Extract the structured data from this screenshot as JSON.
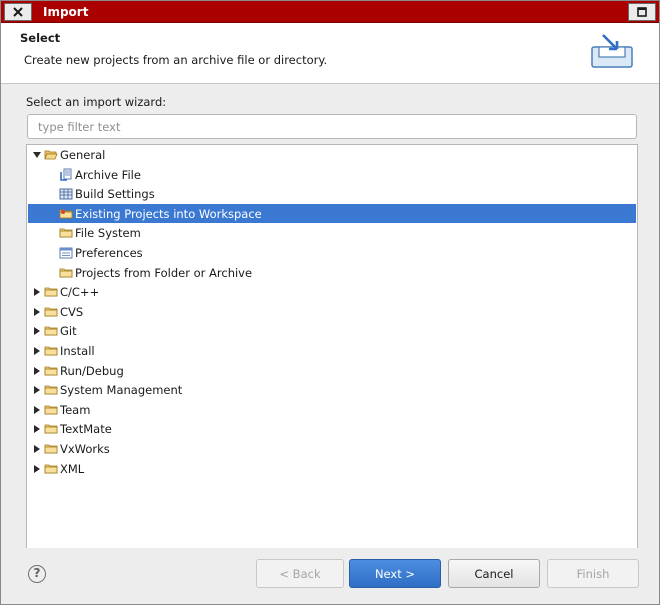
{
  "window": {
    "title": "Import",
    "accent_color": "#ab0000",
    "close_icon": "close-x-icon",
    "maximize_icon": "maximize-icon"
  },
  "header": {
    "title": "Select",
    "description": "Create new projects from an archive file or directory.",
    "icon": "import-wizard-icon"
  },
  "wizard": {
    "label": "Select an import wizard:",
    "filter_placeholder": "type filter text",
    "filter_value": ""
  },
  "tree": {
    "selection_color": "#3a78d2",
    "rows": [
      {
        "label": "General",
        "level": 0,
        "expanded": true,
        "icon": "folder-open-icon"
      },
      {
        "label": "Archive File",
        "level": 1,
        "icon": "archive-file-icon"
      },
      {
        "label": "Build Settings",
        "level": 1,
        "icon": "build-settings-icon"
      },
      {
        "label": "Existing Projects into Workspace",
        "level": 1,
        "icon": "existing-projects-icon",
        "selected": true
      },
      {
        "label": "File System",
        "level": 1,
        "icon": "folder-icon"
      },
      {
        "label": "Preferences",
        "level": 1,
        "icon": "preferences-icon"
      },
      {
        "label": "Projects from Folder or Archive",
        "level": 1,
        "icon": "folder-icon"
      },
      {
        "label": "C/C++",
        "level": 0,
        "expanded": false,
        "icon": "folder-icon"
      },
      {
        "label": "CVS",
        "level": 0,
        "expanded": false,
        "icon": "folder-icon"
      },
      {
        "label": "Git",
        "level": 0,
        "expanded": false,
        "icon": "folder-icon"
      },
      {
        "label": "Install",
        "level": 0,
        "expanded": false,
        "icon": "folder-icon"
      },
      {
        "label": "Run/Debug",
        "level": 0,
        "expanded": false,
        "icon": "folder-icon"
      },
      {
        "label": "System Management",
        "level": 0,
        "expanded": false,
        "icon": "folder-icon"
      },
      {
        "label": "Team",
        "level": 0,
        "expanded": false,
        "icon": "folder-icon"
      },
      {
        "label": "TextMate",
        "level": 0,
        "expanded": false,
        "icon": "folder-icon"
      },
      {
        "label": "VxWorks",
        "level": 0,
        "expanded": false,
        "icon": "folder-icon"
      },
      {
        "label": "XML",
        "level": 0,
        "expanded": false,
        "icon": "folder-icon"
      }
    ]
  },
  "footer": {
    "help_icon": "help-icon",
    "help_glyph": "?",
    "back": "< Back",
    "next": "Next >",
    "cancel": "Cancel",
    "finish": "Finish"
  }
}
